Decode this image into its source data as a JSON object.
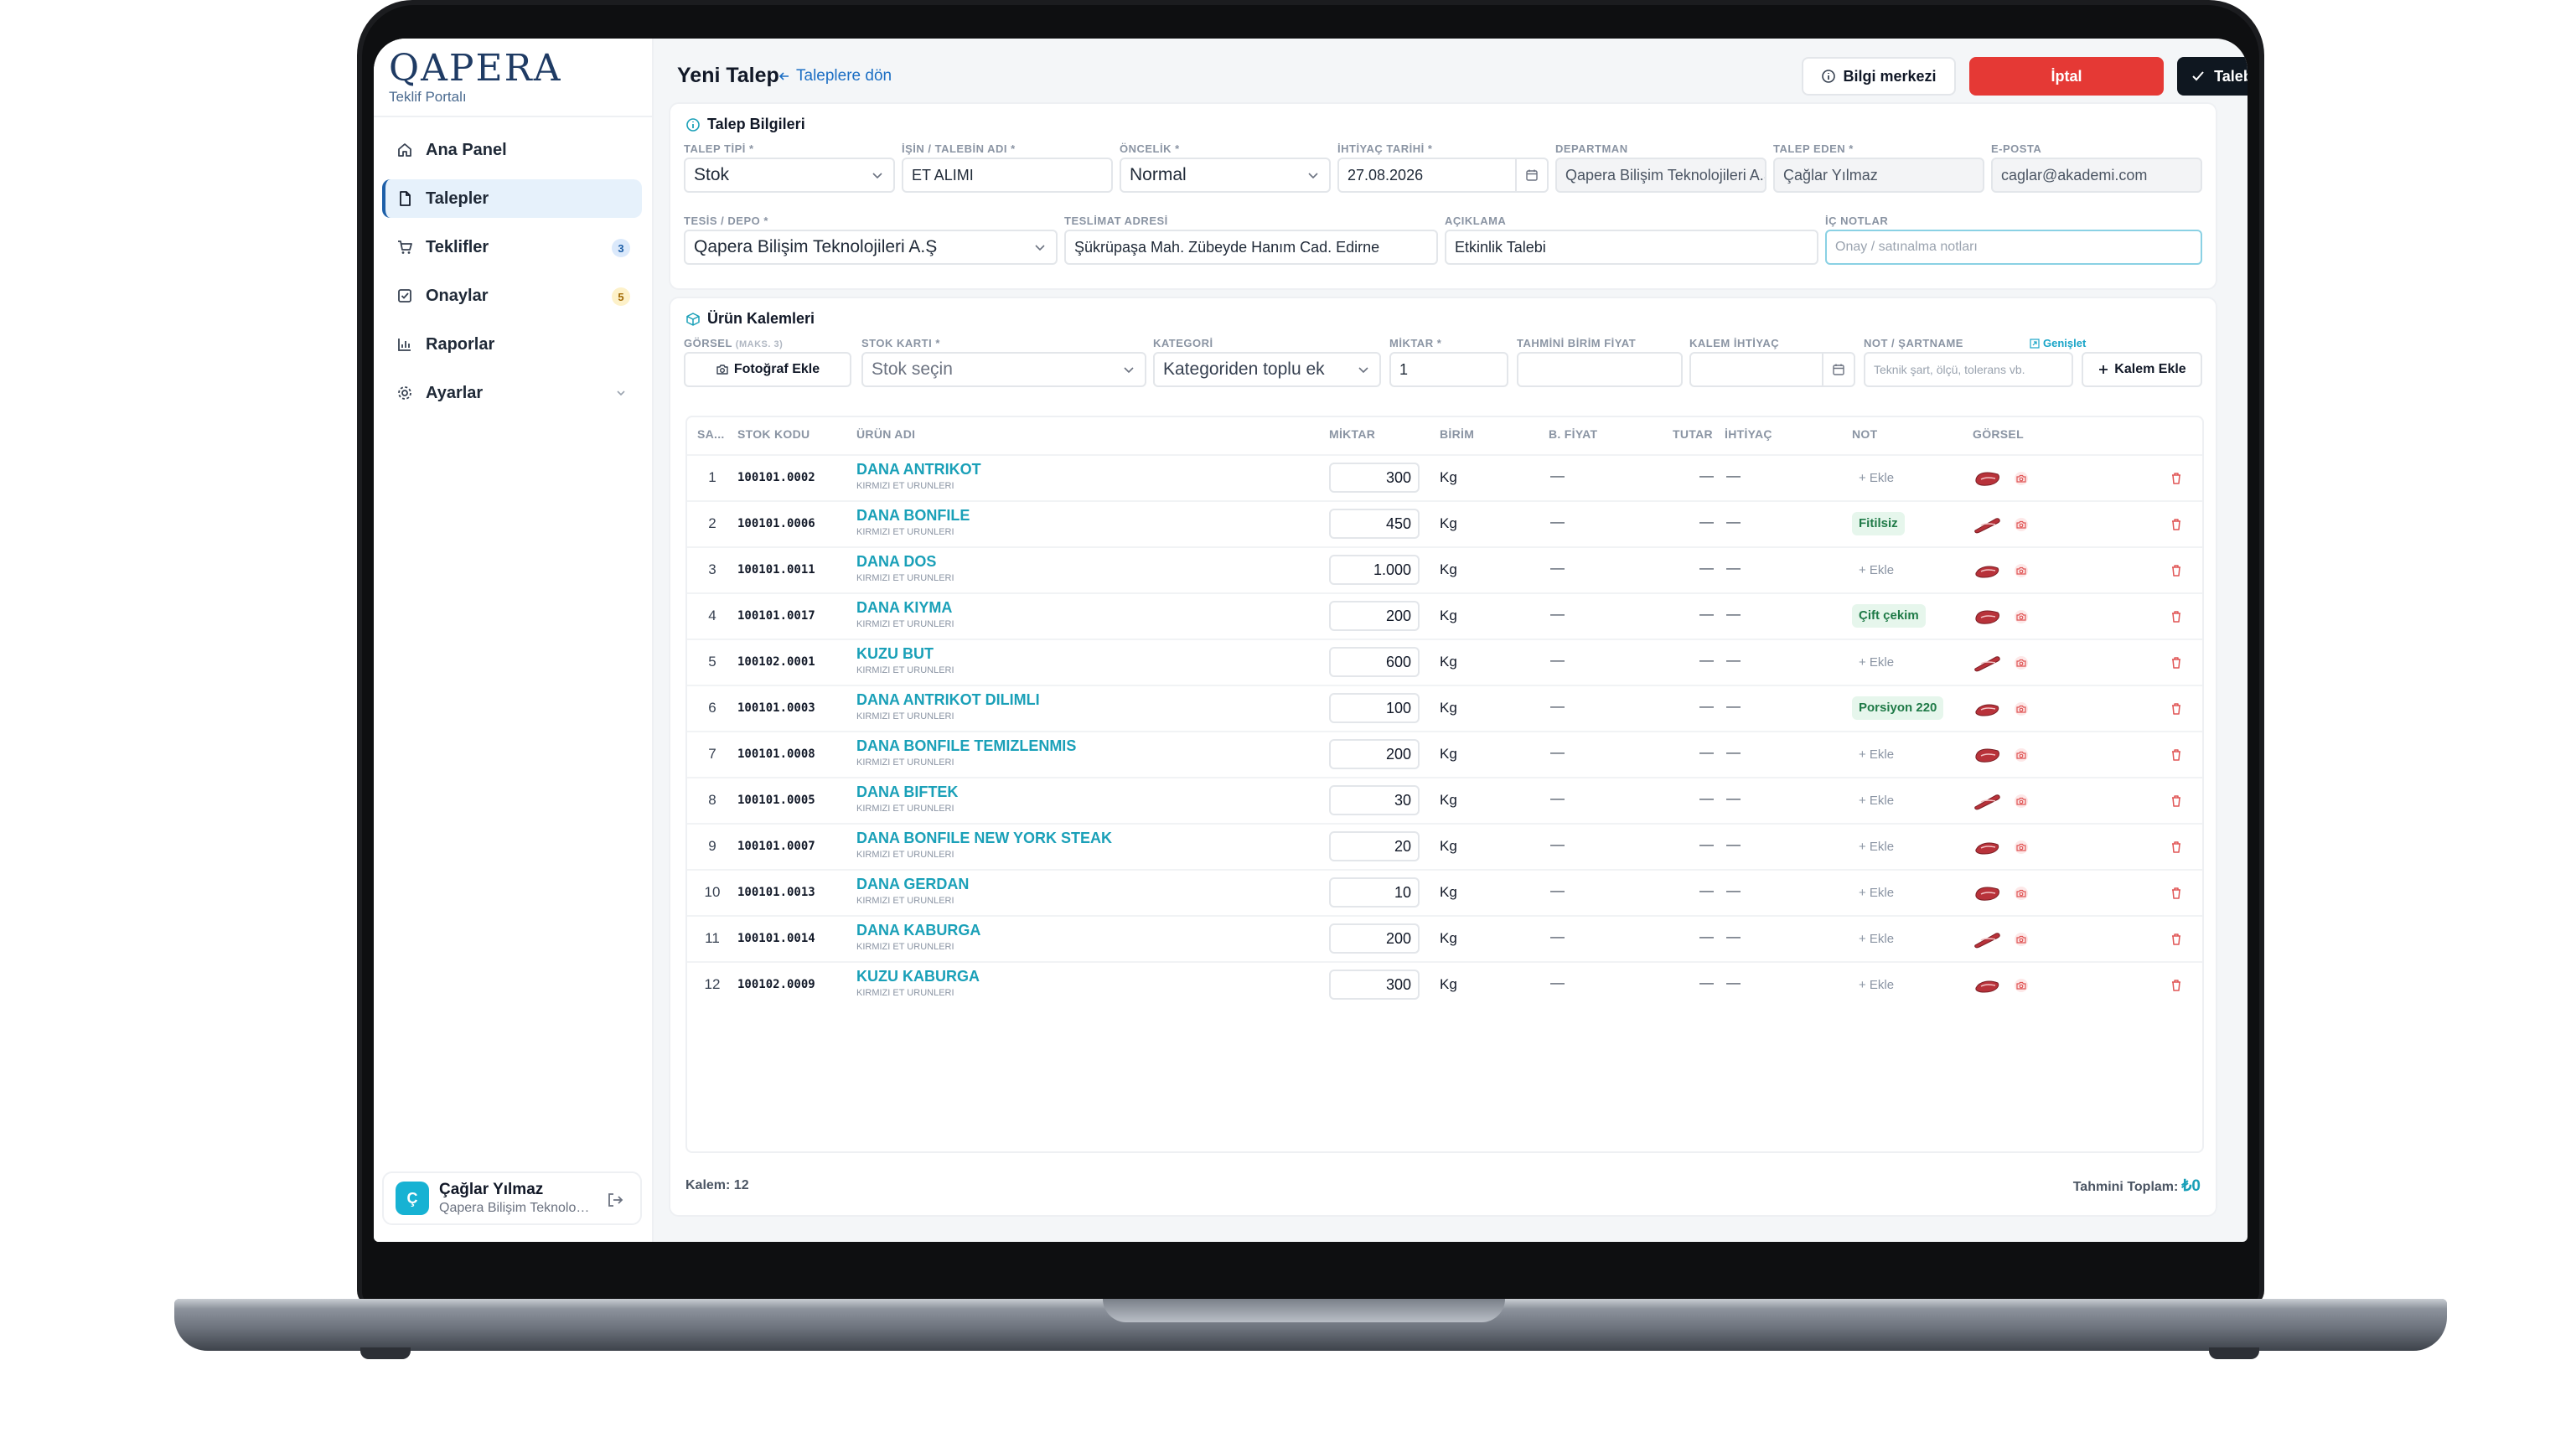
{
  "brand": {
    "logo": "QAPERA",
    "subtitle": "Teklif Portalı"
  },
  "sidebar": {
    "items": [
      {
        "label": "Ana Panel",
        "icon": "home-icon"
      },
      {
        "label": "Talepler",
        "icon": "document-icon",
        "active": true
      },
      {
        "label": "Teklifler",
        "icon": "cart-icon",
        "badge": "3"
      },
      {
        "label": "Onaylar",
        "icon": "check-square-icon",
        "badge": "5"
      },
      {
        "label": "Raporlar",
        "icon": "bar-chart-icon"
      },
      {
        "label": "Ayarlar",
        "icon": "gear-icon"
      }
    ],
    "user": {
      "initial": "Ç",
      "name": "Çağlar Yılmaz",
      "org": "Qapera Bilişim Teknolojileri A.Ş"
    }
  },
  "header": {
    "title": "Yeni Talep",
    "back_label": "Taleplere dön",
    "info_label": "Bilgi merkezi",
    "cancel_label": "İptal",
    "save_label": "Talebi Kaydet"
  },
  "talep": {
    "section_title": "Talep Bilgileri",
    "fields": {
      "talep_tipi": {
        "label": "TALEP TİPİ *",
        "value": "Stok"
      },
      "isin_adi": {
        "label": "İŞİN / TALEBİN ADI *",
        "value": "ET ALIMI"
      },
      "oncelik": {
        "label": "ÖNCELİK *",
        "value": "Normal"
      },
      "ihtiyac_tarihi": {
        "label": "İHTİYAÇ TARİHİ *",
        "value": "27.08.2026"
      },
      "departman": {
        "label": "DEPARTMAN",
        "value": "Qapera Bilişim Teknolojileri A.Ş"
      },
      "talep_eden": {
        "label": "TALEP EDEN *",
        "value": "Çağlar Yılmaz"
      },
      "eposta": {
        "label": "E-POSTA",
        "value": "caglar@akademi.com"
      },
      "tesis": {
        "label": "TESİS / DEPO *",
        "value": "Qapera Bilişim Teknolojileri A.Ş"
      },
      "teslimat": {
        "label": "TESLİMAT ADRESİ",
        "value": "Şükrüpaşa Mah. Zübeyde Hanım Cad. Edirne"
      },
      "aciklama": {
        "label": "AÇIKLAMA",
        "value": "Etkinlik Talebi"
      },
      "ic_notlar": {
        "label": "İÇ NOTLAR",
        "placeholder": "Onay / satınalma notları"
      }
    }
  },
  "urun": {
    "section_title": "Ürün Kalemleri",
    "form": {
      "gorsel_label": "GÖRSEL",
      "gorsel_hint": "(MAKS. 3)",
      "photo_button": "Fotoğraf Ekle",
      "stok_label": "STOK KARTI *",
      "stok_value": "Stok seçin",
      "kategori_label": "KATEGORİ",
      "kategori_value": "Kategoriden toplu ek",
      "miktar_label": "MİKTAR *",
      "miktar_value": "1",
      "fiyat_label": "TAHMİNİ BİRİM FİYAT",
      "ihtiyac_label": "KALEM İHTİYAÇ",
      "not_label": "NOT / ŞARTNAME",
      "genislet": "Genişlet",
      "not_placeholder": "Teknik şart, ölçü, tolerans vb.",
      "add_button": "Kalem Ekle"
    },
    "columns": [
      "SA...",
      "STOK KODU",
      "ÜRÜN ADI",
      "MİKTAR",
      "BİRİM",
      "B. FİYAT",
      "TUTAR",
      "İHTİYAÇ",
      "NOT",
      "GÖRSEL"
    ],
    "rows": [
      {
        "no": "1",
        "code": "100101.0002",
        "name": "DANA ANTRIKOT",
        "cat": "KIRMIZI ET URUNLERI",
        "qty": "300",
        "unit": "Kg",
        "note": "+ Ekle",
        "tag": false
      },
      {
        "no": "2",
        "code": "100101.0006",
        "name": "DANA BONFILE",
        "cat": "KIRMIZI ET URUNLERI",
        "qty": "450",
        "unit": "Kg",
        "note": "Fitilsiz",
        "tag": true
      },
      {
        "no": "3",
        "code": "100101.0011",
        "name": "DANA DOS",
        "cat": "KIRMIZI ET URUNLERI",
        "qty": "1.000",
        "unit": "Kg",
        "note": "+ Ekle",
        "tag": false
      },
      {
        "no": "4",
        "code": "100101.0017",
        "name": "DANA KIYMA",
        "cat": "KIRMIZI ET URUNLERI",
        "qty": "200",
        "unit": "Kg",
        "note": "Çift çekim",
        "tag": true
      },
      {
        "no": "5",
        "code": "100102.0001",
        "name": "KUZU BUT",
        "cat": "KIRMIZI ET URUNLERI",
        "qty": "600",
        "unit": "Kg",
        "note": "+ Ekle",
        "tag": false
      },
      {
        "no": "6",
        "code": "100101.0003",
        "name": "DANA ANTRIKOT DILIMLI",
        "cat": "KIRMIZI ET URUNLERI",
        "qty": "100",
        "unit": "Kg",
        "note": "Porsiyon 220",
        "tag": true
      },
      {
        "no": "7",
        "code": "100101.0008",
        "name": "DANA BONFILE TEMIZLENMIS",
        "cat": "KIRMIZI ET URUNLERI",
        "qty": "200",
        "unit": "Kg",
        "note": "+ Ekle",
        "tag": false
      },
      {
        "no": "8",
        "code": "100101.0005",
        "name": "DANA BIFTEK",
        "cat": "KIRMIZI ET URUNLERI",
        "qty": "30",
        "unit": "Kg",
        "note": "+ Ekle",
        "tag": false
      },
      {
        "no": "9",
        "code": "100101.0007",
        "name": "DANA BONFILE NEW YORK STEAK",
        "cat": "KIRMIZI ET URUNLERI",
        "qty": "20",
        "unit": "Kg",
        "note": "+ Ekle",
        "tag": false
      },
      {
        "no": "10",
        "code": "100101.0013",
        "name": "DANA GERDAN",
        "cat": "KIRMIZI ET URUNLERI",
        "qty": "10",
        "unit": "Kg",
        "note": "+ Ekle",
        "tag": false
      },
      {
        "no": "11",
        "code": "100101.0014",
        "name": "DANA KABURGA",
        "cat": "KIRMIZI ET URUNLERI",
        "qty": "200",
        "unit": "Kg",
        "note": "+ Ekle",
        "tag": false
      },
      {
        "no": "12",
        "code": "100102.0009",
        "name": "KUZU KABURGA",
        "cat": "KIRMIZI ET URUNLERI",
        "qty": "300",
        "unit": "Kg",
        "note": "+ Ekle",
        "tag": false
      }
    ],
    "dash": "—",
    "footer_count": "Kalem: 12",
    "footer_total_label": "Tahmini Toplam:",
    "footer_total_value": "₺0"
  },
  "colors": {
    "accent": "#1aa0b8",
    "primary": "#1d6fc4",
    "danger": "#e53935",
    "dark": "#0f1720"
  }
}
